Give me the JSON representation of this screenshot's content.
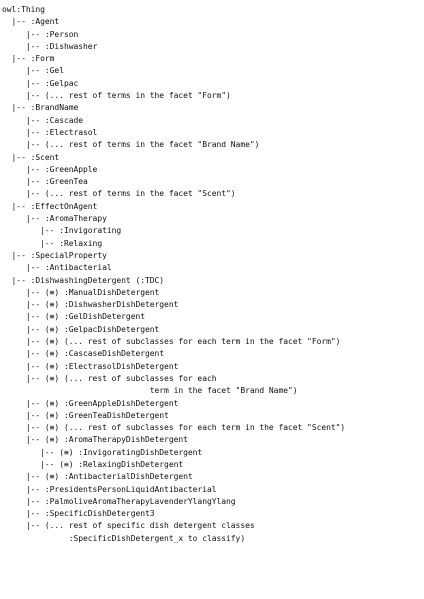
{
  "tree_lines": [
    "owl:Thing",
    "  |-- :Agent",
    "     |-- :Person",
    "     |-- :Dishwasher",
    "  |-- :Form",
    "     |-- :Gel",
    "     |-- :Gelpac",
    "     |-- (... rest of terms in the facet \"Form\")",
    "  |-- :BrandName",
    "     |-- :Cascade",
    "     |-- :Electrasol",
    "     |-- (... rest of terms in the facet \"Brand Name\")",
    "  |-- :Scent",
    "     |-- :GreenApple",
    "     |-- :GreenTea",
    "     |-- (... rest of terms in the facet \"Scent\")",
    "  |-- :EffectOnAgent",
    "     |-- :AromaTherapy",
    "        |-- :Invigorating",
    "        |-- :Relaxing",
    "  |-- :SpecialProperty",
    "     |-- :Antibacterial",
    "  |-- :DishwashingDetergent (:TDC)",
    "     |-- (≡) :ManualDishDetergent",
    "     |-- (≡) :DishwasherDishDetergent",
    "     |-- (≡) :GelDishDetergent",
    "     |-- (≡) :GelpacDishDetergent",
    "     |-- (≡) (... rest of subclasses for each term in the facet \"Form\")",
    "     |-- (≡) :CascaseDishDetergent",
    "     |-- (≡) :ElectrasolDishDetergent",
    "     |-- (≡) (... rest of subclasses for each",
    "                               term in the facet \"Brand Name\")",
    "     |-- (≡) :GreenAppleDishDetergent",
    "     |-- (≡) :GreenTeaDishDetergent",
    "     |-- (≡) (... rest of subclasses for each term in the facet \"Scent\")",
    "     |-- (≡) :AromaTherapyDishDetergent",
    "        |-- (≡) :InvigoratingDishDetergent",
    "        |-- (≡) :RelaxingDishDetergent",
    "     |-- (≡) :AntibacterialDishDetergent",
    "     |-- :PresidentsPersonLiquidAntibacterial",
    "     |-- :PalmoliveAromaTherapyLavenderYlangYlang",
    "     |-- :SpecificDishDetergent3",
    "     |-- (... rest of specific dish detergent classes",
    "              :SpecificDishDetergent_x to classify)"
  ]
}
